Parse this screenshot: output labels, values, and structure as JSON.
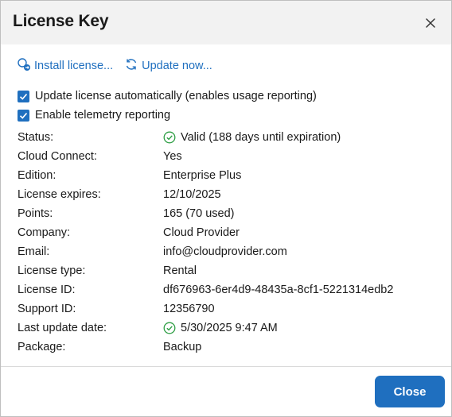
{
  "dialog": {
    "title": "License Key",
    "close_icon": "close-icon"
  },
  "actions": {
    "install": {
      "label": "Install license...",
      "icon": "install-license-icon"
    },
    "update": {
      "label": "Update now...",
      "icon": "refresh-icon"
    }
  },
  "options": {
    "auto_update": {
      "label": "Update license automatically (enables usage reporting)",
      "checked": true
    },
    "telemetry": {
      "label": "Enable telemetry reporting",
      "checked": true
    }
  },
  "properties": [
    {
      "label": "Status:",
      "value": "Valid (188 days until expiration)",
      "icon": "valid-check-icon"
    },
    {
      "label": "Cloud Connect:",
      "value": "Yes"
    },
    {
      "label": "Edition:",
      "value": "Enterprise Plus"
    },
    {
      "label": "License expires:",
      "value": "12/10/2025"
    },
    {
      "label": "Points:",
      "value": "165 (70 used)"
    },
    {
      "label": "Company:",
      "value": "Cloud Provider"
    },
    {
      "label": "Email:",
      "value": "info@cloudprovider.com"
    },
    {
      "label": "License type:",
      "value": "Rental"
    },
    {
      "label": "License ID:",
      "value": "df676963-6er4d9-48435a-8cf1-5221314edb2"
    },
    {
      "label": "Support ID:",
      "value": "12356790"
    },
    {
      "label": "Last update date:",
      "value": "5/30/2025 9:47 AM",
      "icon": "valid-check-icon"
    },
    {
      "label": "Package:",
      "value": "Backup"
    }
  ],
  "footer": {
    "close_label": "Close"
  },
  "colors": {
    "accent": "#1f6fbf",
    "success": "#2e9e44",
    "header_bg": "#f2f2f2"
  }
}
